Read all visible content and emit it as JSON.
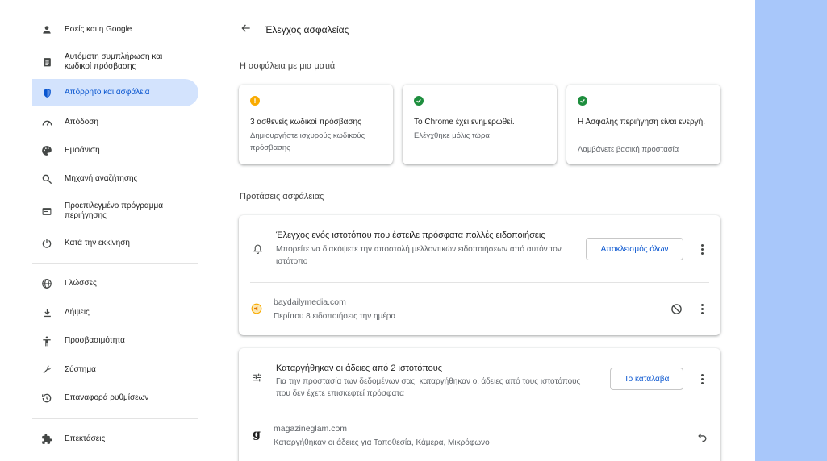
{
  "sidebar": {
    "items": [
      {
        "label": "Εσείς και η Google",
        "icon": "person-icon"
      },
      {
        "label": "Αυτόματη συμπλήρωση και κωδικοί πρόσβασης",
        "icon": "clipboard-icon"
      },
      {
        "label": "Απόρρητο και ασφάλεια",
        "icon": "shield-icon",
        "active": true
      },
      {
        "label": "Απόδοση",
        "icon": "speedometer-icon"
      },
      {
        "label": "Εμφάνιση",
        "icon": "palette-icon"
      },
      {
        "label": "Μηχανή αναζήτησης",
        "icon": "search-icon"
      },
      {
        "label": "Προεπιλεγμένο πρόγραμμα περιήγησης",
        "icon": "browser-icon"
      },
      {
        "label": "Κατά την εκκίνηση",
        "icon": "power-icon"
      },
      {
        "label": "Γλώσσες",
        "icon": "globe-icon"
      },
      {
        "label": "Λήψεις",
        "icon": "download-icon"
      },
      {
        "label": "Προσβασιμότητα",
        "icon": "accessibility-icon"
      },
      {
        "label": "Σύστημα",
        "icon": "wrench-icon"
      },
      {
        "label": "Επαναφορά ρυθμίσεων",
        "icon": "history-icon"
      },
      {
        "label": "Επεκτάσεις",
        "icon": "puzzle-icon"
      }
    ]
  },
  "header": {
    "title": "Έλεγχος ασφαλείας"
  },
  "glance": {
    "section_title": "Η ασφάλεια με μια ματιά",
    "cards": [
      {
        "title": "3 ασθενείς κωδικοί πρόσβασης",
        "subtitle": "Δημιουργήστε ισχυρούς κωδικούς πρόσβασης",
        "status": "warning"
      },
      {
        "title": "Το Chrome έχει ενημερωθεί.",
        "subtitle": "Ελέγχθηκε μόλις τώρα",
        "status": "ok"
      },
      {
        "title": "Η Ασφαλής περιήγηση είναι ενεργή.",
        "subtitle": "Λαμβάνετε βασική προστασία",
        "status": "ok"
      }
    ]
  },
  "suggestions": {
    "section_title": "Προτάσεις ασφάλειας",
    "notifications": {
      "title": "Έλεγχος ενός ιστοτόπου που έστειλε πρόσφατα πολλές ειδοποιήσεις",
      "description": "Μπορείτε να διακόψετε την αποστολή μελλοντικών ειδοποιήσεων από αυτόν τον ιστότοπο",
      "button": "Αποκλεισμός όλων",
      "site": "baydailymedia.com",
      "site_detail": "Περίπου 8 ειδοποιήσεις την ημέρα"
    },
    "permissions": {
      "title": "Καταργήθηκαν οι άδειες από 2 ιστοτόπους",
      "description": "Για την προστασία των δεδομένων σας, καταργήθηκαν οι άδειες από τους ιστοτόπους που δεν έχετε επισκεφτεί πρόσφατα",
      "button": "Το κατάλαβα",
      "site": "magazineglam.com",
      "site_detail": "Καταργήθηκαν οι άδειες για Τοποθεσία, Κάμερα, Μικρόφωνο"
    }
  },
  "colors": {
    "accent": "#0b57d0",
    "active_bg": "#d3e3fd",
    "warning": "#f9ab00",
    "ok": "#1e8e3e",
    "side_strip": "#a8c7fa"
  }
}
